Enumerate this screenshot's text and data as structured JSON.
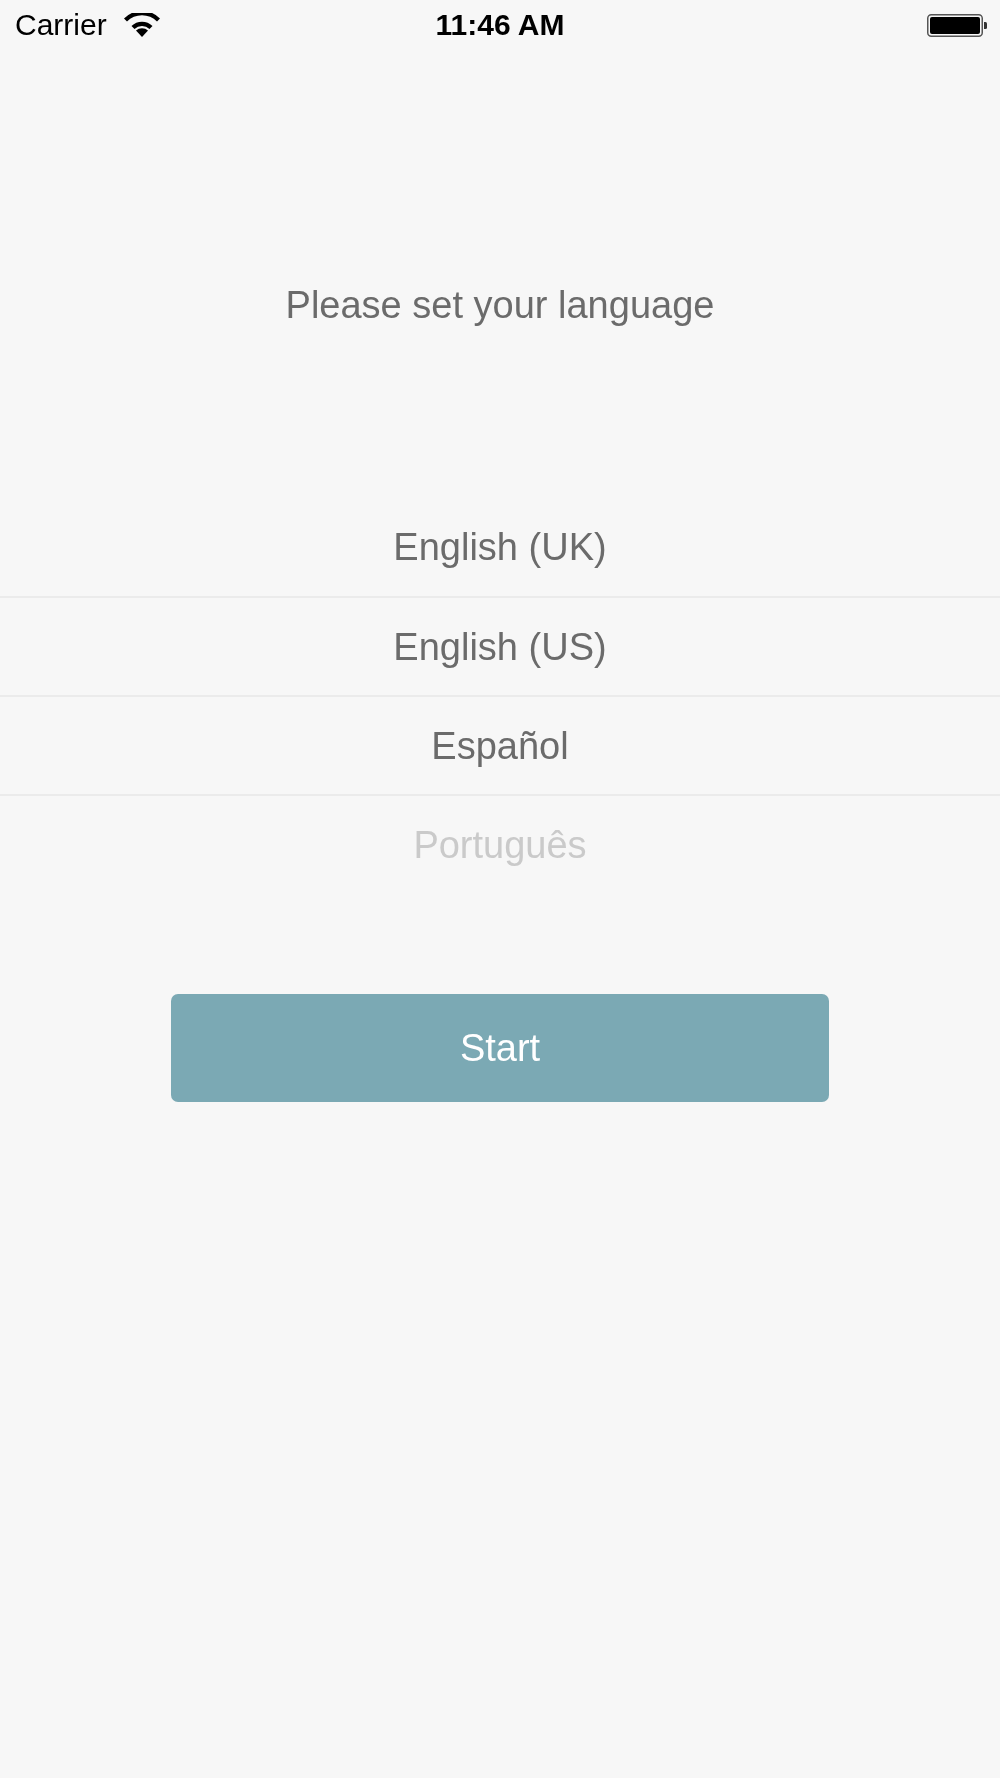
{
  "status_bar": {
    "carrier": "Carrier",
    "time": "11:46 AM"
  },
  "title": "Please set your language",
  "language_picker": {
    "items": [
      {
        "label": "English (UK)",
        "faded": false
      },
      {
        "label": "English (US)",
        "faded": false
      },
      {
        "label": "Español",
        "faded": false
      },
      {
        "label": "Português",
        "faded": true
      }
    ]
  },
  "start_button": {
    "label": "Start"
  }
}
